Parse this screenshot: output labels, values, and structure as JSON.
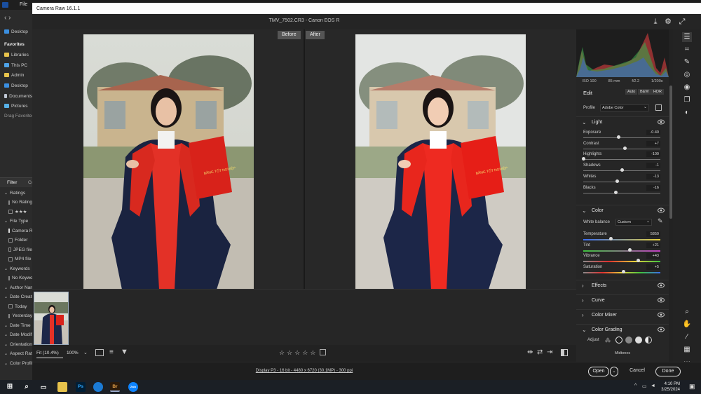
{
  "window": {
    "title": "Camera Raw 16.1.1",
    "file_title": "TMV_7502.CR3  -  Canon EOS R"
  },
  "bridge": {
    "menu_file": "File",
    "favorites_header": "Favorites",
    "favorites": [
      "Desktop",
      "Libraries",
      "This PC",
      "Admin",
      "Desktop",
      "Documents",
      "Pictures"
    ],
    "drag_favorites": "Drag Favorites",
    "filter_tab": "Filter",
    "collections_tab": "Co",
    "filters": [
      {
        "label": "Ratings",
        "type": "head"
      },
      {
        "label": "No Rating",
        "type": "check",
        "on": false
      },
      {
        "label": "★★★",
        "type": "check",
        "on": false
      },
      {
        "label": "File Type",
        "type": "head"
      },
      {
        "label": "Camera Raw",
        "type": "check",
        "on": true
      },
      {
        "label": "Folder",
        "type": "check",
        "on": false
      },
      {
        "label": "JPEG file",
        "type": "check",
        "on": false
      },
      {
        "label": "MP4 file",
        "type": "check",
        "on": false
      },
      {
        "label": "Keywords",
        "type": "head"
      },
      {
        "label": "No Keywords",
        "type": "check",
        "on": false
      },
      {
        "label": "Author Name",
        "type": "head"
      },
      {
        "label": "Date Created",
        "type": "head"
      },
      {
        "label": "Today",
        "type": "check",
        "on": false
      },
      {
        "label": "Yesterday",
        "type": "check",
        "on": false
      },
      {
        "label": "Date Time",
        "type": "head"
      },
      {
        "label": "Date Modified",
        "type": "head"
      },
      {
        "label": "Orientation",
        "type": "head"
      },
      {
        "label": "Aspect Ratio",
        "type": "head"
      },
      {
        "label": "Color Profile",
        "type": "head"
      }
    ]
  },
  "view": {
    "before_label": "Before",
    "after_label": "After"
  },
  "photo_text": {
    "certificate": "BẰNG TỐT NGHIỆP"
  },
  "bottom": {
    "zoom_fit": "Fit (10.4%)",
    "zoom_100": "100%",
    "stars": [
      "☆",
      "☆",
      "☆",
      "☆",
      "☆"
    ],
    "display_info": "Display P3 - 16 bit - 4480 x 6720 (30.1MP) - 300 ppi",
    "open_label": "Open",
    "cancel_label": "Cancel",
    "done_label": "Done"
  },
  "exif": {
    "iso": "ISO 100",
    "focal": "85 mm",
    "aperture": "f/2.2",
    "shutter": "1/200s"
  },
  "edit": {
    "title": "Edit",
    "auto_label": "Auto",
    "bw_label": "B&W",
    "hdr_label": "HDR",
    "profile_label": "Profile",
    "profile_value": "Adobe Color"
  },
  "light": {
    "title": "Light",
    "sliders": [
      {
        "label": "Exposure",
        "value": "-0.40",
        "pos": 0.46
      },
      {
        "label": "Contrast",
        "value": "+7",
        "pos": 0.54
      },
      {
        "label": "Highlights",
        "value": "-100",
        "pos": 0.0
      },
      {
        "label": "Shadows",
        "value": "-1",
        "pos": 0.5
      },
      {
        "label": "Whites",
        "value": "-13",
        "pos": 0.44
      },
      {
        "label": "Blacks",
        "value": "-16",
        "pos": 0.42
      }
    ]
  },
  "color": {
    "title": "Color",
    "wb_label": "White balance",
    "wb_value": "Custom",
    "sliders": [
      {
        "label": "Temperature",
        "value": "5850",
        "pos": 0.36,
        "grad": "linear-gradient(90deg,#3a6df0,#e8d23a)"
      },
      {
        "label": "Tint",
        "value": "+21",
        "pos": 0.6,
        "grad": "linear-gradient(90deg,#3fc13f,#c23fc2)"
      },
      {
        "label": "Vibrance",
        "value": "+43",
        "pos": 0.71,
        "grad": "linear-gradient(90deg,#8a8a8a,#e0302f,#e8d23a,#3fc13f)"
      },
      {
        "label": "Saturation",
        "value": "+5",
        "pos": 0.52,
        "grad": "linear-gradient(90deg,#8a8a8a,#e0302f,#e8d23a,#3fc13f,#3a6df0)"
      }
    ]
  },
  "sections": {
    "effects": "Effects",
    "curve": "Curve",
    "color_mixer": "Color Mixer",
    "color_grading": "Color Grading",
    "adjust_label": "Adjust",
    "midtones_label": "Midtones"
  },
  "taskbar": {
    "time": "4:10 PM",
    "date": "3/25/2024",
    "ps_label": "Ps",
    "br_label": "Br",
    "zalo_label": "Zalo"
  }
}
